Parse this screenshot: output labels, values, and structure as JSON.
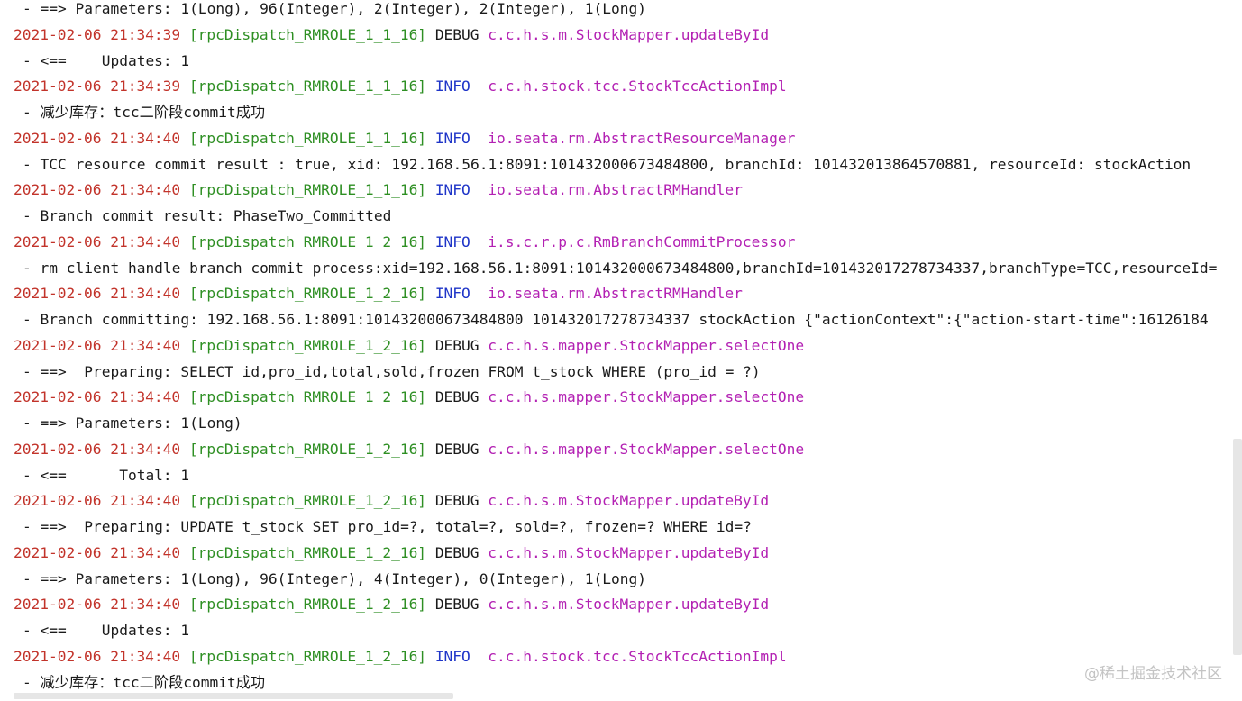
{
  "colors": {
    "timestamp": "#c2332a",
    "thread": "#2e8f23",
    "info": "#1f35c8",
    "debug": "#1a1a1a",
    "logger": "#b321b3"
  },
  "watermark": "@稀土掘金技术社区",
  "lines": [
    {
      "kind": "msg",
      "text": "- ==> Parameters: 1(Long), 96(Integer), 2(Integer), 2(Integer), 1(Long)"
    },
    {
      "kind": "head",
      "ts": "2021-02-06 21:34:39",
      "thread": "[rpcDispatch_RMROLE_1_1_16]",
      "level": "DEBUG",
      "logger": "c.c.h.s.m.StockMapper.updateById"
    },
    {
      "kind": "msg",
      "text": "- <==    Updates: 1"
    },
    {
      "kind": "head",
      "ts": "2021-02-06 21:34:39",
      "thread": "[rpcDispatch_RMROLE_1_1_16]",
      "level": "INFO ",
      "logger": "c.c.h.stock.tcc.StockTccActionImpl"
    },
    {
      "kind": "msg",
      "text": "- 减少库存：tcc二阶段commit成功"
    },
    {
      "kind": "head",
      "ts": "2021-02-06 21:34:40",
      "thread": "[rpcDispatch_RMROLE_1_1_16]",
      "level": "INFO ",
      "logger": "io.seata.rm.AbstractResourceManager"
    },
    {
      "kind": "msg",
      "text": "- TCC resource commit result : true, xid: 192.168.56.1:8091:101432000673484800, branchId: 101432013864570881, resourceId: stockAction"
    },
    {
      "kind": "head",
      "ts": "2021-02-06 21:34:40",
      "thread": "[rpcDispatch_RMROLE_1_1_16]",
      "level": "INFO ",
      "logger": "io.seata.rm.AbstractRMHandler"
    },
    {
      "kind": "msg",
      "text": "- Branch commit result: PhaseTwo_Committed"
    },
    {
      "kind": "head",
      "ts": "2021-02-06 21:34:40",
      "thread": "[rpcDispatch_RMROLE_1_2_16]",
      "level": "INFO ",
      "logger": "i.s.c.r.p.c.RmBranchCommitProcessor"
    },
    {
      "kind": "msg",
      "text": "- rm client handle branch commit process:xid=192.168.56.1:8091:101432000673484800,branchId=101432017278734337,branchType=TCC,resourceId="
    },
    {
      "kind": "head",
      "ts": "2021-02-06 21:34:40",
      "thread": "[rpcDispatch_RMROLE_1_2_16]",
      "level": "INFO ",
      "logger": "io.seata.rm.AbstractRMHandler"
    },
    {
      "kind": "msg",
      "text": "- Branch committing: 192.168.56.1:8091:101432000673484800 101432017278734337 stockAction {\"actionContext\":{\"action-start-time\":16126184"
    },
    {
      "kind": "head",
      "ts": "2021-02-06 21:34:40",
      "thread": "[rpcDispatch_RMROLE_1_2_16]",
      "level": "DEBUG",
      "logger": "c.c.h.s.mapper.StockMapper.selectOne"
    },
    {
      "kind": "msg",
      "text": "- ==>  Preparing: SELECT id,pro_id,total,sold,frozen FROM t_stock WHERE (pro_id = ?)"
    },
    {
      "kind": "head",
      "ts": "2021-02-06 21:34:40",
      "thread": "[rpcDispatch_RMROLE_1_2_16]",
      "level": "DEBUG",
      "logger": "c.c.h.s.mapper.StockMapper.selectOne"
    },
    {
      "kind": "msg",
      "text": "- ==> Parameters: 1(Long)"
    },
    {
      "kind": "head",
      "ts": "2021-02-06 21:34:40",
      "thread": "[rpcDispatch_RMROLE_1_2_16]",
      "level": "DEBUG",
      "logger": "c.c.h.s.mapper.StockMapper.selectOne"
    },
    {
      "kind": "msg",
      "text": "- <==      Total: 1"
    },
    {
      "kind": "head",
      "ts": "2021-02-06 21:34:40",
      "thread": "[rpcDispatch_RMROLE_1_2_16]",
      "level": "DEBUG",
      "logger": "c.c.h.s.m.StockMapper.updateById"
    },
    {
      "kind": "msg",
      "text": "- ==>  Preparing: UPDATE t_stock SET pro_id=?, total=?, sold=?, frozen=? WHERE id=?"
    },
    {
      "kind": "head",
      "ts": "2021-02-06 21:34:40",
      "thread": "[rpcDispatch_RMROLE_1_2_16]",
      "level": "DEBUG",
      "logger": "c.c.h.s.m.StockMapper.updateById"
    },
    {
      "kind": "msg",
      "text": "- ==> Parameters: 1(Long), 96(Integer), 4(Integer), 0(Integer), 1(Long)"
    },
    {
      "kind": "head",
      "ts": "2021-02-06 21:34:40",
      "thread": "[rpcDispatch_RMROLE_1_2_16]",
      "level": "DEBUG",
      "logger": "c.c.h.s.m.StockMapper.updateById"
    },
    {
      "kind": "msg",
      "text": "- <==    Updates: 1"
    },
    {
      "kind": "head",
      "ts": "2021-02-06 21:34:40",
      "thread": "[rpcDispatch_RMROLE_1_2_16]",
      "level": "INFO ",
      "logger": "c.c.h.stock.tcc.StockTccActionImpl"
    },
    {
      "kind": "msg",
      "text": "- 减少库存：tcc二阶段commit成功"
    }
  ]
}
